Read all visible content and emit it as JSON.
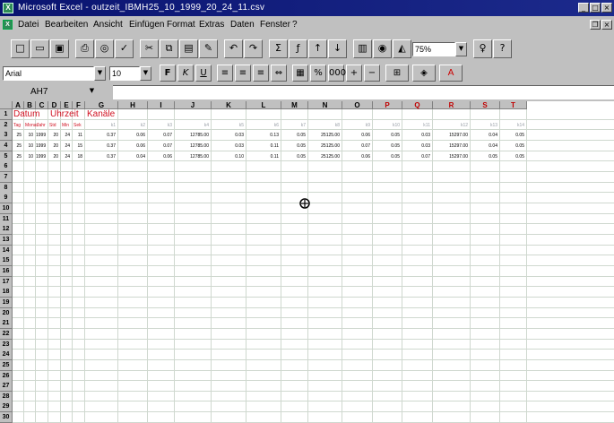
{
  "window": {
    "app_icon": "excel-app-icon",
    "title": "Microsoft Excel - outzeit_IBMH25_10_1999_20_24_11.csv",
    "buttons": [
      "minimize-icon",
      "maximize-icon",
      "close-icon"
    ],
    "doc_buttons": [
      "restore-icon",
      "close-icon"
    ]
  },
  "menu": {
    "items": [
      "Datei",
      "Bearbeiten",
      "Ansicht",
      "Einfügen",
      "Format",
      "Extras",
      "Daten",
      "Fenster",
      "?"
    ]
  },
  "toolbar": {
    "standard_icons": [
      "new-icon",
      "open-icon",
      "save-icon",
      "print-icon",
      "print-preview-icon",
      "spelling-icon",
      "cut-icon",
      "copy-icon",
      "paste-icon",
      "format-painter-icon",
      "undo-icon",
      "redo-icon",
      "autosum-icon",
      "function-icon",
      "sort-ascending-icon",
      "sort-descending-icon",
      "chart-wizard-icon",
      "map-icon",
      "drawing-icon"
    ],
    "zoom_value": "75%",
    "extra_icons": [
      "tip-wizard-icon",
      "help-icon"
    ],
    "formatting_icons": [
      "bold-icon",
      "italic-icon",
      "underline-icon",
      "align-left-icon",
      "align-center-icon",
      "align-right-icon",
      "merge-center-icon",
      "currency-icon",
      "percent-icon",
      "thousands-icon",
      "increase-decimal-icon",
      "decrease-decimal-icon",
      "borders-icon",
      "fill-color-icon",
      "font-color-icon"
    ],
    "font_name": "Arial",
    "font_size": "10"
  },
  "formula_bar": {
    "name_box": "AH7",
    "content": ""
  },
  "sheet": {
    "columns": [
      "A",
      "B",
      "C",
      "D",
      "E",
      "F",
      "G",
      "H",
      "I",
      "J",
      "K",
      "L",
      "M",
      "N",
      "O",
      "P",
      "Q",
      "R",
      "S",
      "T"
    ],
    "row_numbers": [
      "1",
      "2",
      "3",
      "4",
      "5",
      "6",
      "7",
      "8",
      "9",
      "10",
      "11",
      "12",
      "13",
      "14",
      "15",
      "16",
      "17",
      "18",
      "19",
      "20",
      "21",
      "22",
      "23",
      "24",
      "25",
      "26",
      "27",
      "28",
      "29",
      "30"
    ],
    "header_row1": {
      "datum": "Datum",
      "uhrzeit": "Uhrzeit",
      "kanaele": "Kanäle"
    },
    "header_row2": {
      "labels": [
        "Tag",
        "Monat",
        "Jahr",
        "Std",
        "Min",
        "Sek"
      ],
      "channels": [
        "k1",
        "k2",
        "k3",
        "k4",
        "k5",
        "k6",
        "k7",
        "k8",
        "k9",
        "k10",
        "k11",
        "k12",
        "k13",
        "k14"
      ]
    },
    "data_rows": [
      [
        "25",
        "10",
        "1999",
        "20",
        "24",
        "11",
        "0.37",
        "0.06",
        "0.07",
        "12785.00",
        "0.03",
        "0.13",
        "0.05",
        "25125.00",
        "0.06",
        "0.05",
        "0.03",
        "15297.00",
        "0.04",
        "0.05"
      ],
      [
        "25",
        "10",
        "1999",
        "20",
        "24",
        "15",
        "0.37",
        "0.06",
        "0.07",
        "12785.00",
        "0.03",
        "0.11",
        "0.05",
        "25125.00",
        "0.07",
        "0.05",
        "0.03",
        "15297.00",
        "0.04",
        "0.05"
      ],
      [
        "25",
        "10",
        "1999",
        "20",
        "24",
        "18",
        "0.37",
        "0.04",
        "0.06",
        "12785.00",
        "0.10",
        "0.11",
        "0.05",
        "25125.00",
        "0.06",
        "0.05",
        "0.07",
        "15297.00",
        "0.05",
        "0.05"
      ]
    ]
  }
}
